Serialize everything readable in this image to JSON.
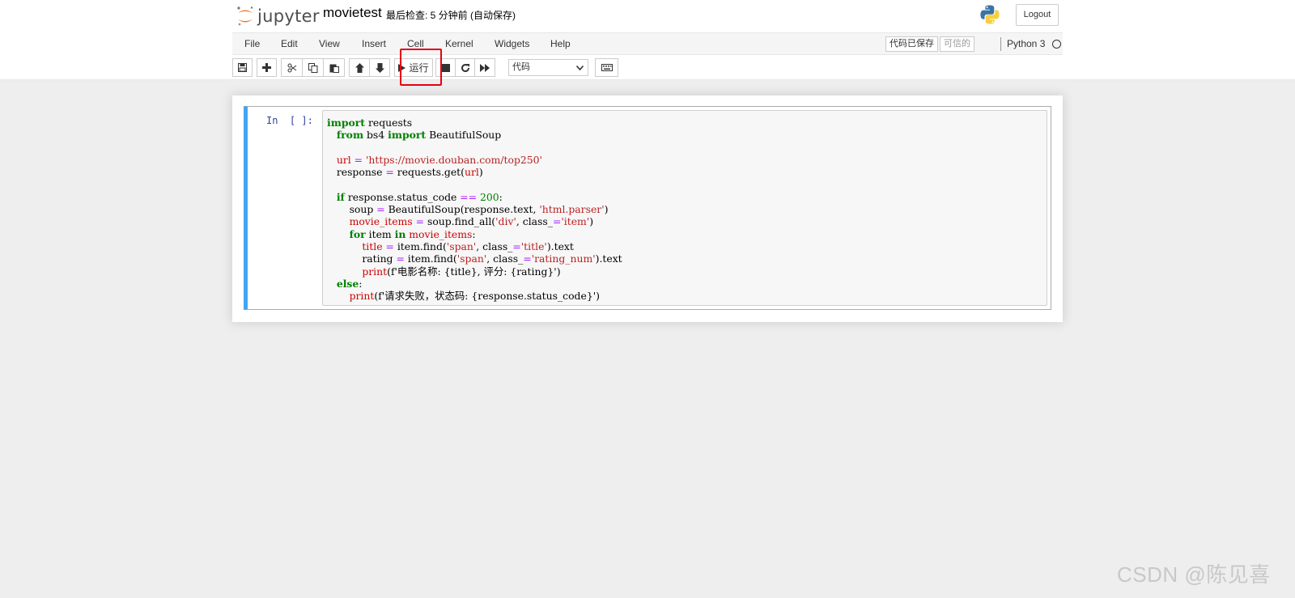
{
  "header": {
    "logo_text": "jupyter",
    "notebook_name": "movietest",
    "checkpoint": "最后检查: 5 分钟前  (自动保存)",
    "logout_label": "Logout"
  },
  "menu": {
    "items": [
      "File",
      "Edit",
      "View",
      "Insert",
      "Cell",
      "Kernel",
      "Widgets",
      "Help"
    ],
    "trusted_label": "代码已保存",
    "readonly_label": "可信的",
    "kernel_name": "Python 3"
  },
  "toolbar": {
    "run_label": "运行",
    "cell_type": "代码",
    "buttons": [
      "save-icon",
      "plus-icon",
      "cut-icon",
      "copy-icon",
      "paste-icon",
      "arrow-up-icon",
      "arrow-down-icon",
      "play-icon",
      "stop-icon",
      "restart-icon",
      "fast-forward-icon",
      "keyboard-icon"
    ]
  },
  "cell": {
    "prompt": "In  [ ]:",
    "code_lines": [
      "import requests",
      "   from bs4 import BeautifulSoup",
      "",
      "   url = 'https://movie.douban.com/top250'",
      "   response = requests.get(url)",
      "",
      "   if response.status_code == 200:",
      "       soup = BeautifulSoup(response.text, 'html.parser')",
      "       movie_items = soup.find_all('div', class_='item')",
      "       for item in movie_items:",
      "           title = item.find('span', class_='title').text",
      "           rating = item.find('span', class_='rating_num').text",
      "           print(f'电影名称: {title}, 评分: {rating}')",
      "   else:",
      "       print(f'请求失败，状态码: {response.status_code}')"
    ]
  },
  "watermark": "CSDN @陈见喜",
  "colors": {
    "accent_cell_border": "#42a5f5",
    "highlight_box": "#e60012",
    "keyword": "#008000",
    "string": "#ba2121"
  }
}
